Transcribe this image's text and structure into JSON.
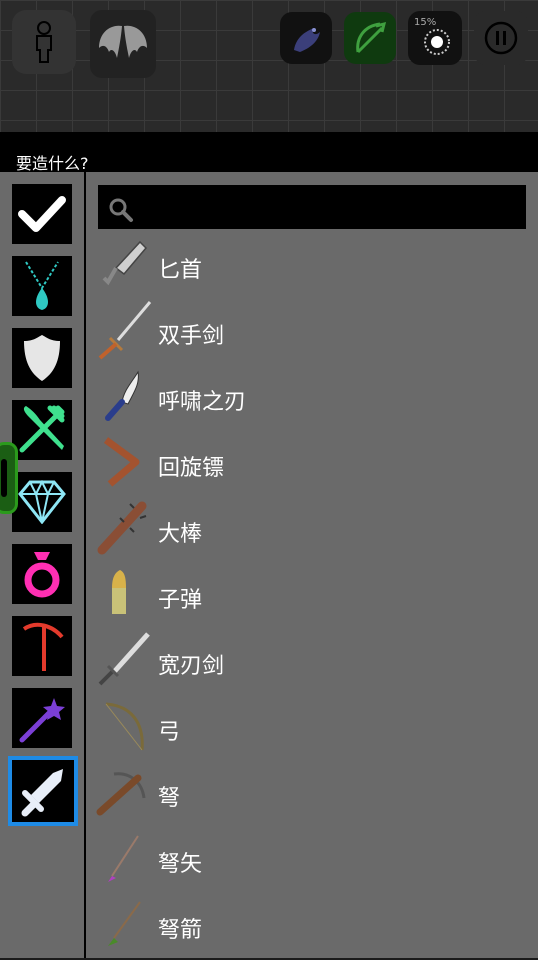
{
  "hud": {
    "fx_percent": "15%"
  },
  "dialog": {
    "title": "要造什么?",
    "search": {
      "placeholder": ""
    }
  },
  "categories": [
    {
      "name": "all",
      "icon": "check-icon"
    },
    {
      "name": "necklace",
      "icon": "necklace-icon"
    },
    {
      "name": "armor",
      "icon": "shield-icon"
    },
    {
      "name": "food",
      "icon": "fork-knife-icon"
    },
    {
      "name": "gem",
      "icon": "diamond-icon"
    },
    {
      "name": "ring",
      "icon": "ring-icon"
    },
    {
      "name": "tools",
      "icon": "pickaxe-icon"
    },
    {
      "name": "magic",
      "icon": "wand-icon"
    },
    {
      "name": "weapons",
      "icon": "sword-icon",
      "selected": true
    }
  ],
  "items": [
    {
      "label": "匕首",
      "icon": "dagger-icon"
    },
    {
      "label": "双手剑",
      "icon": "two-handed-sword-icon"
    },
    {
      "label": "呼啸之刃",
      "icon": "howling-blade-icon"
    },
    {
      "label": "回旋镖",
      "icon": "boomerang-icon"
    },
    {
      "label": "大棒",
      "icon": "club-icon"
    },
    {
      "label": "子弹",
      "icon": "bullet-icon"
    },
    {
      "label": "宽刃剑",
      "icon": "broadsword-icon"
    },
    {
      "label": "弓",
      "icon": "bow-icon"
    },
    {
      "label": "弩",
      "icon": "crossbow-icon"
    },
    {
      "label": "弩矢",
      "icon": "crossbow-bolt-icon"
    },
    {
      "label": "弩箭",
      "icon": "crossbow-arrow-icon"
    }
  ],
  "colors": {
    "selected_border": "#1e8be6",
    "panel_bg": "#6a6a6a"
  }
}
